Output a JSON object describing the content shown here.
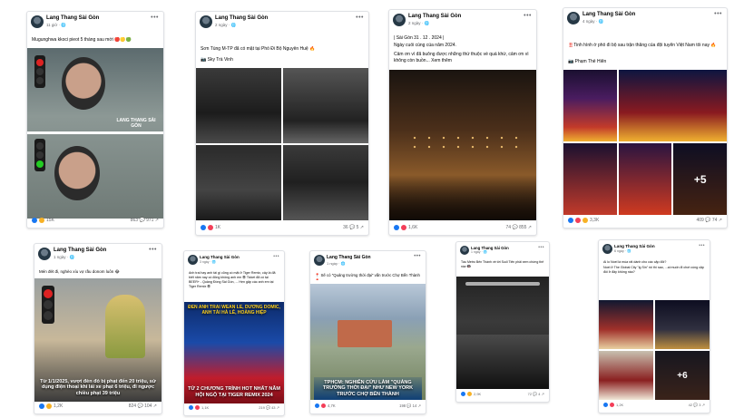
{
  "page_name": "Lang Thang Sài Gòn",
  "posts": [
    {
      "time": "11 giờ · 🌐",
      "text": "Mugunghwa kkoci pieot 5 tháng sau mới 🔴🟡🟢",
      "watermark": "LANG THANG SÀI GÒN",
      "reactions": "15K",
      "stats": "863 💬   971 ↗"
    },
    {
      "time": "2 ngày · 🌐",
      "text": "Sơn Tùng M-TP đã có mặt tại Phố Đi Bộ Nguyễn Huệ 🔥",
      "credit": "📷 Sky Trà Vinh",
      "reactions": "1K",
      "stats": "36 💬   5 ↗"
    },
    {
      "time": "2 ngày · 🌐",
      "text": "| Sài Gòn 31 . 12 . 2024 |",
      "text2": "Ngày cuối cùng của năm 2024.",
      "text3": "Cảm ơn vì đã buông được những thứ thuộc về quá khứ, cảm ơn vì không còn buồn... Xem thêm",
      "reactions": "1,6K",
      "stats": "74 💬   855 ↗"
    },
    {
      "time": "4 ngày · 🌐",
      "text": "‼️Tinh hình ở phố đi bộ sau trận thắng của đội tuyển Việt Nam tối nay 🔥",
      "credit": "📷 Phạm Thế Hiển",
      "plus": "+5",
      "reactions": "3,3K",
      "stats": "409 💬   74 ↗"
    },
    {
      "time": "1 ngày · 🌐",
      "text": "Mén đét đi, nghèo xíu vợ rầu donom luôn 😂",
      "banner": "Từ 1/1/2025, vượt đèn đỏ bị phạt đến 20 triệu, sử dụng điện thoại khi lái xe phạt 6 triệu, đi ngược chiều phạt 39 triệu",
      "reactions": "1,2K",
      "stats": "824 💬   104 ↗"
    },
    {
      "time": "3 ngày · 🌐",
      "text": "Anh trai hay anh tài gì cũng có mặt ở Tiger Remix, cây là đã biết năm nay có đông không anh em 😎 Ticket đã có tại BEER+ - Quảng Đồng Sài Gòn, ... Hẹn gặp các anh em tại Tiger Remix 😎",
      "poster_top": "ĐEN ANH TRAI WEAN LE, DƯƠNG DOMIC, ANH TÀI HÀ LÊ, HOÀNG HIỆP",
      "poster_bottom": "TỪ 2 CHƯƠNG TRÌNH HOT NHẤT NĂM HỘI NGỘ TẠI TIGER REMIX 2024",
      "reactions": "1,1K",
      "stats": "219 💬   43 ↗"
    },
    {
      "time": "1 ngày · 🌐",
      "text": "📍 Sẽ có \"Quảng trường thời đại\" vấn trước Chợ Bến Thành 📍",
      "banner": "TPHCM: NGHIÊN CỨU LÀM \"QUẢNG TRƯỜNG THỜI ĐẠI\" NHƯ NEW YORK TRƯỚC CHỢ BẾN THÀNH",
      "reactions": "4,7K",
      "stats": "198 💬   14 ↗"
    },
    {
      "time": "1 ngày · 🌐",
      "text": "Tàu Metro Bến Thành về tới Suối Tiên phải xem chừng thế này 🚇",
      "reactions": "2,9K",
      "stats": "72 💬   4 ↗"
    },
    {
      "time": "6 ngày · 🌐",
      "text": "Ai lo Noel là mùa rất dành cho các cặp đôi?",
      "text2": "Noel ở The Global City \"lg Sin\" rồi thì sao, ...ai muốn đi chơi cùng cặp đôi ở đây không nào?",
      "plus": "+6",
      "reactions": "1,2K",
      "stats": "42 💬   3 ↗"
    }
  ]
}
